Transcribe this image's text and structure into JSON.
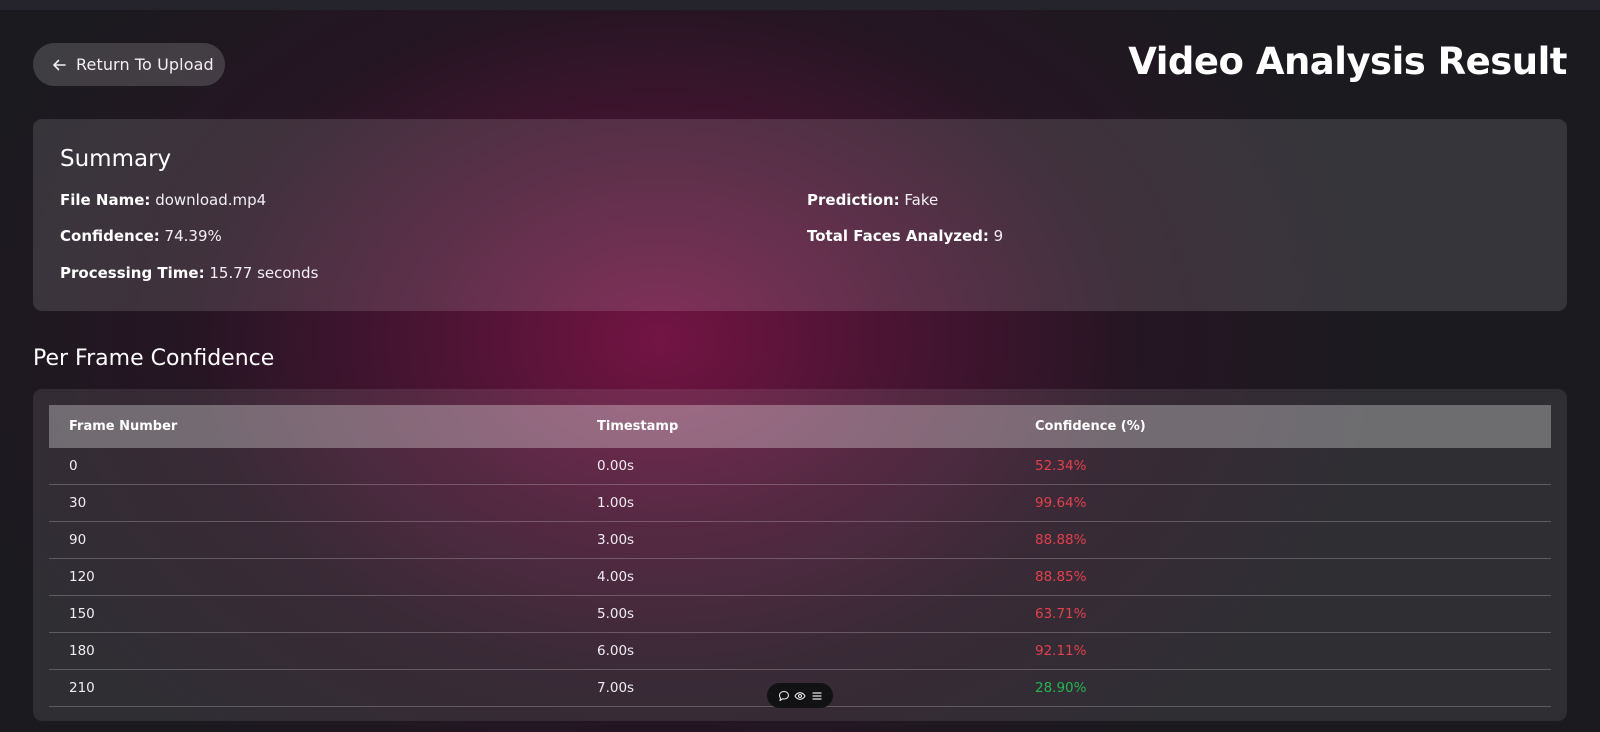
{
  "header": {
    "return_label": "Return To Upload",
    "page_title": "Video Analysis Result"
  },
  "summary": {
    "title": "Summary",
    "file_name_label": "File Name:",
    "file_name": "download.mp4",
    "prediction_label": "Prediction:",
    "prediction": "Fake",
    "confidence_label": "Confidence:",
    "confidence": "74.39%",
    "faces_label": "Total Faces Analyzed:",
    "faces": "9",
    "time_label": "Processing Time:",
    "time": "15.77 seconds"
  },
  "frames": {
    "title": "Per Frame Confidence",
    "columns": [
      "Frame Number",
      "Timestamp",
      "Confidence (%)"
    ],
    "rows": [
      {
        "frame": "0",
        "timestamp": "0.00s",
        "confidence": "52.34%",
        "status": "high"
      },
      {
        "frame": "30",
        "timestamp": "1.00s",
        "confidence": "99.64%",
        "status": "high"
      },
      {
        "frame": "90",
        "timestamp": "3.00s",
        "confidence": "88.88%",
        "status": "high"
      },
      {
        "frame": "120",
        "timestamp": "4.00s",
        "confidence": "88.85%",
        "status": "high"
      },
      {
        "frame": "150",
        "timestamp": "5.00s",
        "confidence": "63.71%",
        "status": "high"
      },
      {
        "frame": "180",
        "timestamp": "6.00s",
        "confidence": "92.11%",
        "status": "high"
      },
      {
        "frame": "210",
        "timestamp": "7.00s",
        "confidence": "28.90%",
        "status": "low"
      }
    ]
  },
  "toolbar": {
    "icons": [
      "comment-icon",
      "eye-icon",
      "menu-icon"
    ]
  },
  "colors": {
    "fake_confidence": "#e2404d",
    "real_confidence": "#22b552",
    "accent_bg": "#6b1446"
  }
}
